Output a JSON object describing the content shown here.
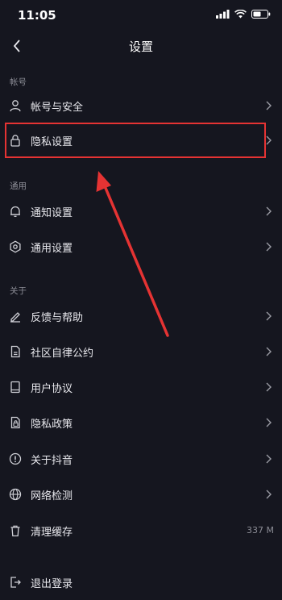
{
  "status_bar": {
    "time": "11:05"
  },
  "nav": {
    "title": "设置"
  },
  "sections": [
    {
      "header": "帐号",
      "items": [
        {
          "label": "帐号与安全",
          "icon": "person-icon"
        },
        {
          "label": "隐私设置",
          "icon": "lock-icon",
          "highlighted": true
        }
      ]
    },
    {
      "header": "通用",
      "items": [
        {
          "label": "通知设置",
          "icon": "bell-icon"
        },
        {
          "label": "通用设置",
          "icon": "gear-icon"
        }
      ]
    },
    {
      "header": "关于",
      "items": [
        {
          "label": "反馈与帮助",
          "icon": "edit-icon"
        },
        {
          "label": "社区自律公约",
          "icon": "document-icon"
        },
        {
          "label": "用户协议",
          "icon": "book-icon"
        },
        {
          "label": "隐私政策",
          "icon": "policy-icon"
        },
        {
          "label": "关于抖音",
          "icon": "info-icon"
        },
        {
          "label": "网络检测",
          "icon": "globe-icon"
        },
        {
          "label": "清理缓存",
          "icon": "trash-icon",
          "value": "337 M"
        },
        {
          "label": "退出登录",
          "icon": "logout-icon"
        }
      ]
    }
  ],
  "colors": {
    "background": "#15161f",
    "highlight_box": "#e53333",
    "annotation_arrow": "#e53333"
  }
}
